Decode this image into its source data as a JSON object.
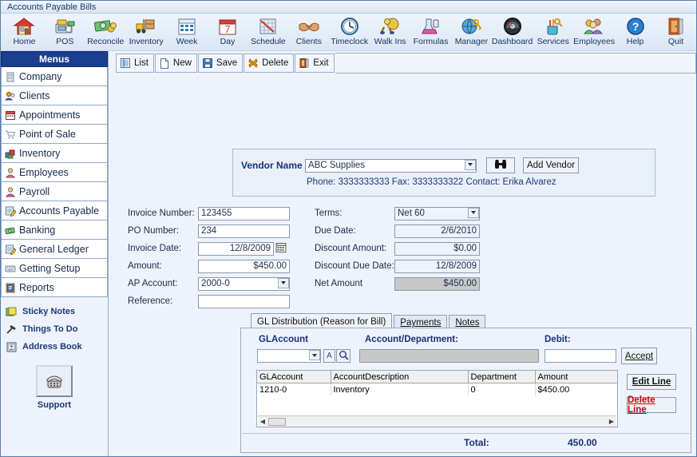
{
  "window": {
    "title": "Accounts Payable Bills"
  },
  "toolbar": {
    "items": [
      {
        "label": "Home",
        "icon": "home-icon"
      },
      {
        "label": "POS",
        "icon": "pos-register-icon"
      },
      {
        "label": "Reconcile",
        "icon": "money-icon"
      },
      {
        "label": "Inventory",
        "icon": "forklift-icon"
      },
      {
        "label": "Week",
        "icon": "calendar-week-icon"
      },
      {
        "label": "Day",
        "icon": "calendar-day-icon"
      },
      {
        "label": "Schedule",
        "icon": "schedule-grid-icon"
      },
      {
        "label": "Clients",
        "icon": "handshake-icon"
      },
      {
        "label": "Timeclock",
        "icon": "clock-icon"
      },
      {
        "label": "Walk Ins",
        "icon": "walkin-person-icon"
      },
      {
        "label": "Formulas",
        "icon": "flask-icon"
      },
      {
        "label": "Manager",
        "icon": "globe-key-icon"
      },
      {
        "label": "Dashboard",
        "icon": "gauge-icon"
      },
      {
        "label": "Services",
        "icon": "tools-cup-icon"
      },
      {
        "label": "Employees",
        "icon": "people-icon"
      },
      {
        "label": "Help",
        "icon": "help-question-icon"
      },
      {
        "label": "Quit",
        "icon": "exit-door-icon"
      }
    ]
  },
  "subtoolbar": {
    "items": [
      {
        "label": "List",
        "icon": "list-icon"
      },
      {
        "label": "New",
        "icon": "new-document-icon"
      },
      {
        "label": "Save",
        "icon": "floppy-save-icon"
      },
      {
        "label": "Delete",
        "icon": "delete-x-icon"
      },
      {
        "label": "Exit",
        "icon": "exit-door-icon"
      }
    ]
  },
  "sidebar": {
    "header": "Menus",
    "items": [
      {
        "label": "Company",
        "icon": "building-icon"
      },
      {
        "label": "Clients",
        "icon": "clients-icon"
      },
      {
        "label": "Appointments",
        "icon": "calendar-icon"
      },
      {
        "label": "Point of Sale",
        "icon": "cart-icon"
      },
      {
        "label": "Inventory",
        "icon": "boxes-icon"
      },
      {
        "label": "Employees",
        "icon": "person-icon"
      },
      {
        "label": "Payroll",
        "icon": "payroll-person-icon"
      },
      {
        "label": "Accounts Payable",
        "icon": "ledger-pencil-icon"
      },
      {
        "label": "Banking",
        "icon": "money-bills-icon"
      },
      {
        "label": "General Ledger",
        "icon": "ledger-pencil-icon"
      },
      {
        "label": "Getting Setup",
        "icon": "keyboard-icon"
      },
      {
        "label": "Reports",
        "icon": "report-book-icon"
      }
    ],
    "sublinks": [
      {
        "label": "Sticky Notes",
        "icon": "sticky-note-icon"
      },
      {
        "label": "Things To Do",
        "icon": "hammer-icon"
      },
      {
        "label": "Address Book",
        "icon": "address-book-icon"
      }
    ],
    "support": {
      "label": "Support",
      "icon": "telephone-icon"
    }
  },
  "vendor": {
    "name_label": "Vendor Name",
    "name_value": "ABC Supplies",
    "search_icon": "binoculars-icon",
    "add_button": "Add Vendor",
    "info_line": "Phone: 3333333333 Fax: 3333333322 Contact: Erika Alvarez"
  },
  "invoice": {
    "left": [
      {
        "label": "Invoice Number:",
        "value": "123455",
        "type": "text",
        "align": "left"
      },
      {
        "label": "PO Number:",
        "value": "234",
        "type": "text",
        "align": "left"
      },
      {
        "label": "Invoice Date:",
        "value": "12/8/2009",
        "type": "date",
        "align": "right"
      },
      {
        "label": "Amount:",
        "value": "$450.00",
        "type": "text",
        "align": "right"
      },
      {
        "label": "AP Account:",
        "value": "2000-0",
        "type": "combo",
        "align": "left"
      },
      {
        "label": "Reference:",
        "value": "",
        "type": "text",
        "align": "left"
      }
    ],
    "right": [
      {
        "label": "Terms:",
        "value": "Net 60",
        "type": "combo",
        "align": "left"
      },
      {
        "label": "Due Date:",
        "value": "2/6/2010",
        "type": "readonly",
        "align": "right"
      },
      {
        "label": "Discount Amount:",
        "value": "$0.00",
        "type": "readonly",
        "align": "right"
      },
      {
        "label": "Discount Due Date:",
        "value": "12/8/2009",
        "type": "readonly",
        "align": "right"
      },
      {
        "label": "Net Amount",
        "value": "$450.00",
        "type": "gray",
        "align": "right"
      }
    ],
    "calendar_icon": "calendar-picker-icon"
  },
  "tabs": [
    {
      "label": "GL Distribution (Reason for Bill)",
      "active": true
    },
    {
      "label": "Payments",
      "active": false
    },
    {
      "label": "Notes",
      "active": false
    }
  ],
  "gl": {
    "glaccount_label": "GLAccount",
    "glaccount_value": "",
    "alpha_button": "A",
    "search_icon": "magnifier-icon",
    "accountdept_label": "Account/Department:",
    "accountdept_value": "",
    "debit_label": "Debit:",
    "debit_value": "",
    "accept_button": "Accept",
    "edit_button": "Edit Line",
    "delete_button": "Delete Line",
    "columns": [
      "GLAccount",
      "AccountDescription",
      "Department",
      "Amount"
    ],
    "rows": [
      [
        "1210-0",
        "Inventory",
        "0",
        "$450.00"
      ]
    ],
    "total_label": "Total:",
    "total_value": "450.00"
  },
  "colors": {
    "menu_header": "#1b3f8f",
    "accent_blue": "#16337a",
    "delete_red": "#d00000",
    "page_bg": "#eef2fb"
  }
}
